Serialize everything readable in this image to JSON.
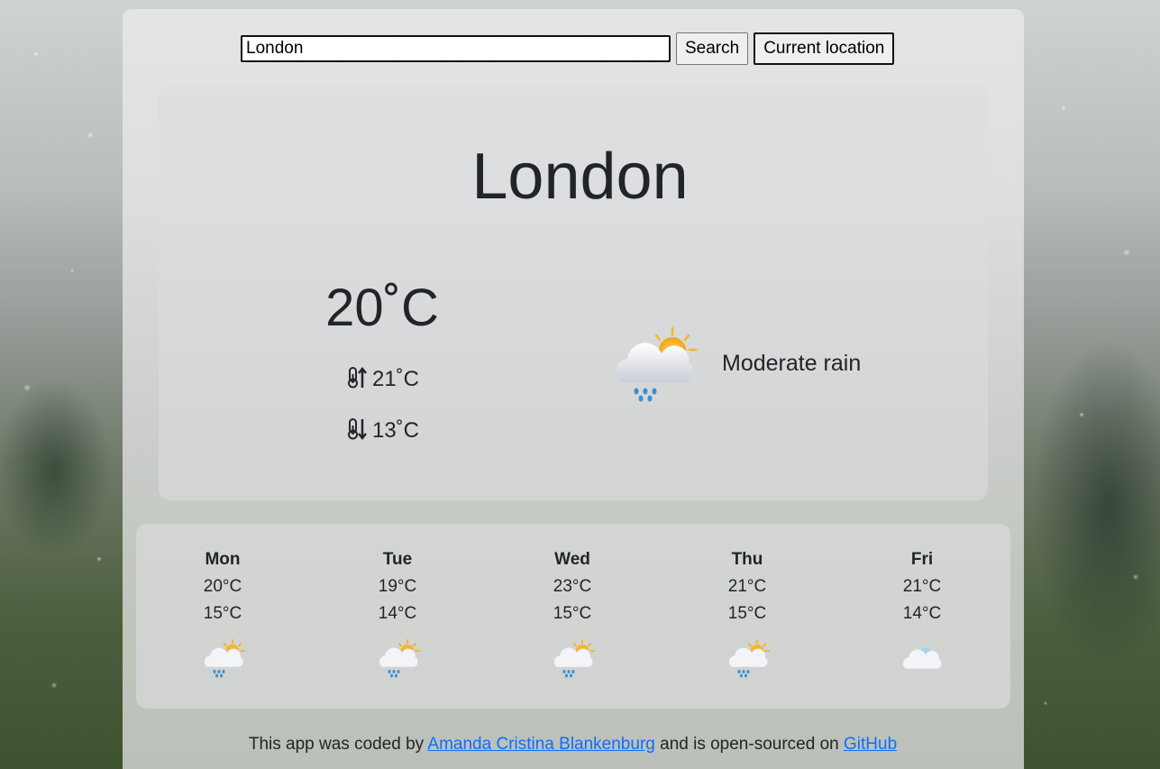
{
  "search": {
    "value": "London",
    "button_label": "Search",
    "location_button_label": "Current location"
  },
  "current": {
    "city": "London",
    "temperature": "20˚C",
    "max_temp": "21˚C",
    "min_temp": "13˚C",
    "condition": "Moderate rain",
    "condition_icon": "sun-cloud-rain-icon"
  },
  "forecast": [
    {
      "day": "Mon",
      "high": "20°C",
      "low": "15°C",
      "icon": "sun-cloud-rain-icon"
    },
    {
      "day": "Tue",
      "high": "19°C",
      "low": "14°C",
      "icon": "sun-cloud-rain-icon"
    },
    {
      "day": "Wed",
      "high": "23°C",
      "low": "15°C",
      "icon": "sun-cloud-rain-icon"
    },
    {
      "day": "Thu",
      "high": "21°C",
      "low": "15°C",
      "icon": "sun-cloud-rain-icon"
    },
    {
      "day": "Fri",
      "high": "21°C",
      "low": "14°C",
      "icon": "cloud-icon"
    }
  ],
  "footer": {
    "prefix": "This app was coded by",
    "author_link": "Amanda Cristina Blankenburg",
    "middle": "and is open-sourced on",
    "repo_link": "GitHub"
  },
  "colors": {
    "link": "#0d6efd",
    "text": "#212529",
    "sun": "#f5b52a",
    "rain": "#3a8fd6"
  }
}
